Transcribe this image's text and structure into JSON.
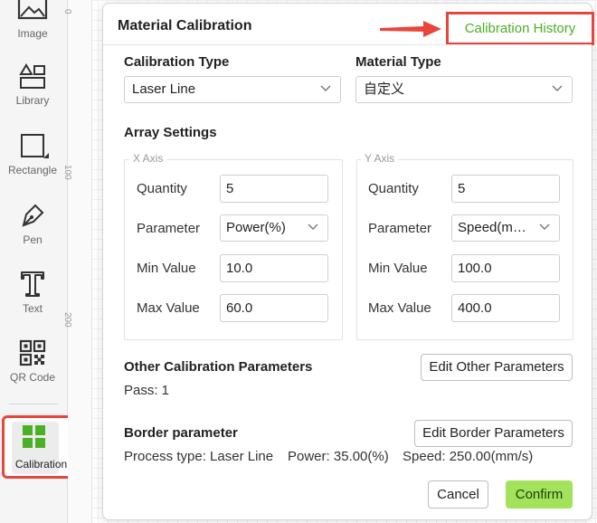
{
  "toolbar": {
    "items": [
      {
        "label": "Image",
        "icon": "image-icon"
      },
      {
        "label": "Library",
        "icon": "library-icon"
      },
      {
        "label": "Rectangle",
        "icon": "rectangle-icon"
      },
      {
        "label": "Pen",
        "icon": "pen-icon"
      },
      {
        "label": "Text",
        "icon": "text-icon"
      },
      {
        "label": "QR Code",
        "icon": "qr-code-icon"
      },
      {
        "label": "Calibration",
        "icon": "calibration-icon"
      }
    ],
    "active_color": "#4caf28"
  },
  "ruler": {
    "labels": [
      "0",
      "100",
      "200"
    ]
  },
  "dialog": {
    "title": "Material Calibration",
    "history_label": "Calibration History",
    "calibration_type": {
      "label": "Calibration Type",
      "value": "Laser Line"
    },
    "material_type": {
      "label": "Material Type",
      "value": "自定义"
    },
    "array_settings": {
      "title": "Array Settings",
      "x_axis": {
        "label": "X Axis",
        "quantity_label": "Quantity",
        "quantity": "5",
        "parameter_label": "Parameter",
        "parameter": "Power(%)",
        "min_label": "Min Value",
        "min": "10.0",
        "max_label": "Max Value",
        "max": "60.0"
      },
      "y_axis": {
        "label": "Y Axis",
        "quantity_label": "Quantity",
        "quantity": "5",
        "parameter_label": "Parameter",
        "parameter": "Speed(m…",
        "min_label": "Min Value",
        "min": "100.0",
        "max_label": "Max Value",
        "max": "400.0"
      }
    },
    "other_params": {
      "title": "Other Calibration Parameters",
      "edit_label": "Edit Other Parameters",
      "pass_text": "Pass: 1"
    },
    "border_params": {
      "title": "Border parameter",
      "edit_label": "Edit Border Parameters",
      "process_type": "Process type: Laser Line",
      "power": "Power: 35.00(%)",
      "speed": "Speed: 250.00(mm/s)"
    },
    "cancel_label": "Cancel",
    "confirm_label": "Confirm"
  },
  "colors": {
    "accent": "#a3e35b",
    "highlight": "#e8453c",
    "history_text": "#4caf28"
  }
}
